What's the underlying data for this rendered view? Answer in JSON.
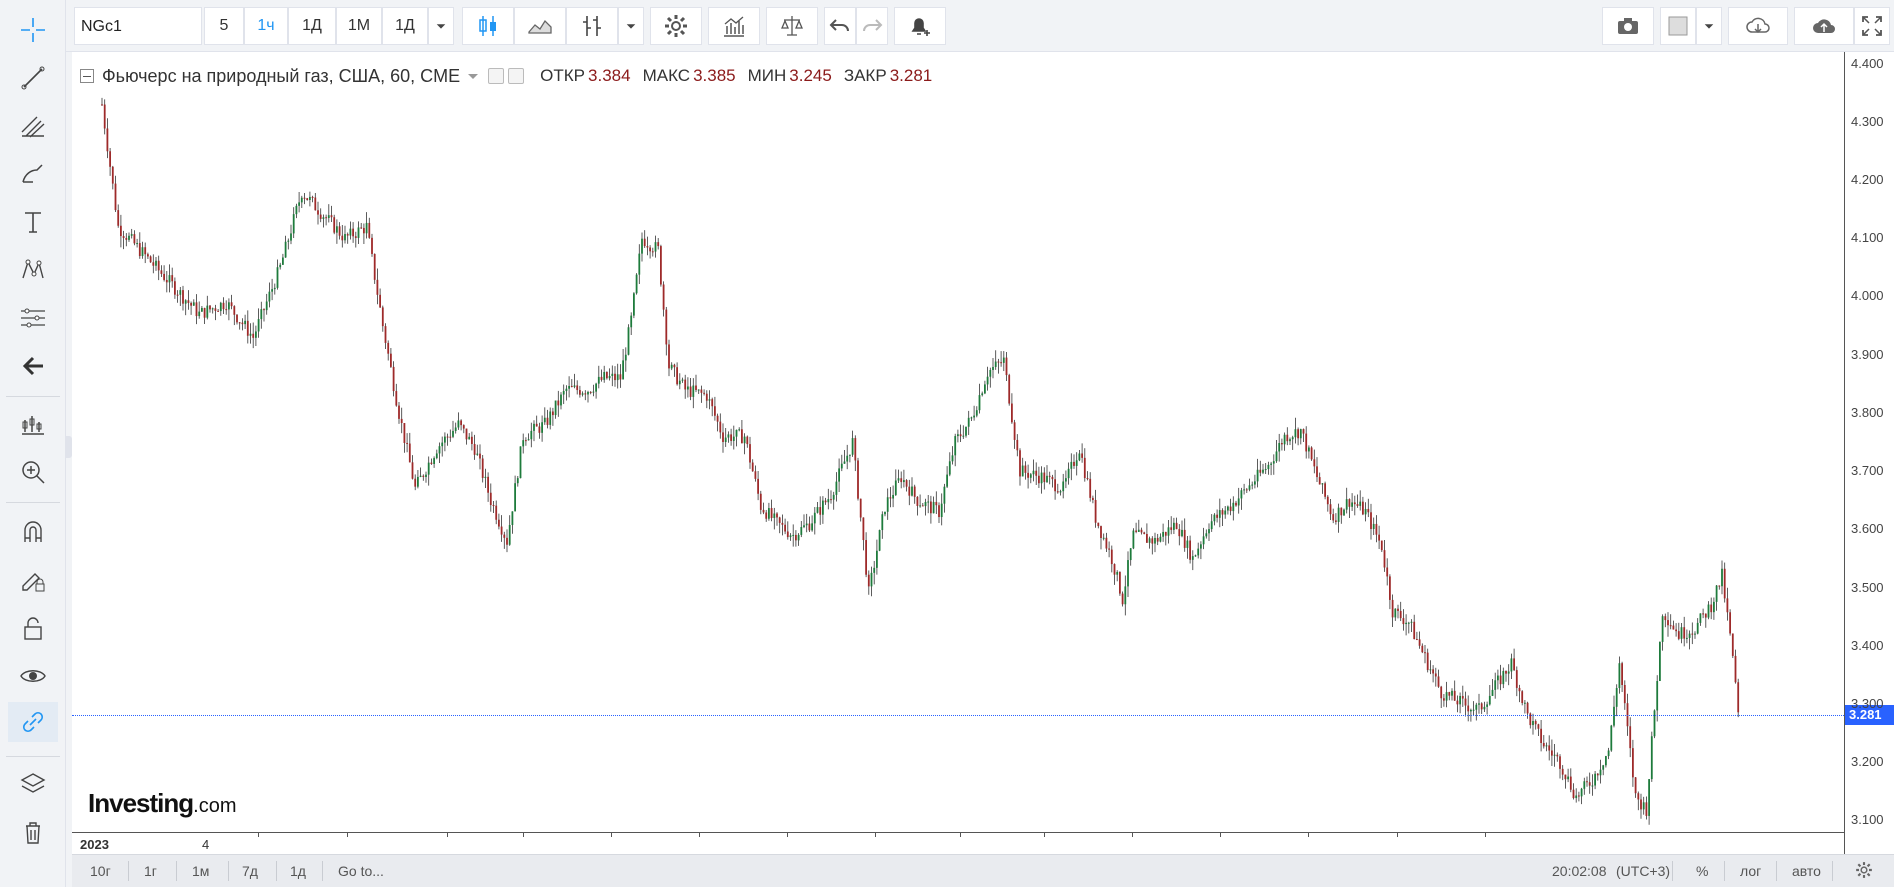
{
  "toolbar": {
    "symbol": "NGc1",
    "intervals": [
      "5",
      "1ч",
      "1Д",
      "1М",
      "1Д"
    ],
    "active_interval": "1ч"
  },
  "legend": {
    "title": "Фьючерс на природный газ, США, 60, CME",
    "open_label": "ОТКР",
    "open": "3.384",
    "high_label": "МАКС",
    "high": "3.385",
    "low_label": "МИН",
    "low": "3.245",
    "close_label": "ЗАКР",
    "close": "3.281"
  },
  "price_axis": {
    "ticks": [
      "4.400",
      "4.300",
      "4.200",
      "4.100",
      "4.000",
      "3.900",
      "3.800",
      "3.700",
      "3.600",
      "3.500",
      "3.400",
      "3.300",
      "3.200",
      "3.100"
    ],
    "current_price": "3.281"
  },
  "time_axis": {
    "labels": [
      "2023",
      "4"
    ]
  },
  "logo": {
    "brand": "Investing",
    "suffix": ".com"
  },
  "bottom_bar": {
    "ranges": [
      "10г",
      "1г",
      "1м",
      "7д",
      "1д"
    ],
    "goto": "Go to...",
    "time": "20:02:08",
    "tz": "(UTC+3)",
    "percent": "%",
    "log": "лог",
    "auto": "авто"
  },
  "colors": {
    "up": "#1e7b3c",
    "down": "#9e2a2a",
    "accent": "#2962ff"
  },
  "chart_data": {
    "type": "candlestick",
    "ylim": [
      3.08,
      4.42
    ],
    "anchors": [
      [
        0,
        4.33
      ],
      [
        6,
        4.12
      ],
      [
        16,
        4.07
      ],
      [
        26,
        4.02
      ],
      [
        36,
        3.97
      ],
      [
        46,
        3.99
      ],
      [
        56,
        3.93
      ],
      [
        66,
        4.05
      ],
      [
        74,
        4.18
      ],
      [
        82,
        4.14
      ],
      [
        90,
        4.1
      ],
      [
        98,
        4.12
      ],
      [
        104,
        3.95
      ],
      [
        110,
        3.8
      ],
      [
        116,
        3.67
      ],
      [
        124,
        3.74
      ],
      [
        132,
        3.78
      ],
      [
        138,
        3.74
      ],
      [
        144,
        3.65
      ],
      [
        150,
        3.58
      ],
      [
        156,
        3.76
      ],
      [
        164,
        3.78
      ],
      [
        172,
        3.84
      ],
      [
        180,
        3.84
      ],
      [
        186,
        3.86
      ],
      [
        192,
        3.86
      ],
      [
        196,
        3.96
      ],
      [
        200,
        4.1
      ],
      [
        206,
        4.08
      ],
      [
        210,
        3.88
      ],
      [
        216,
        3.84
      ],
      [
        224,
        3.83
      ],
      [
        230,
        3.76
      ],
      [
        238,
        3.76
      ],
      [
        244,
        3.64
      ],
      [
        250,
        3.61
      ],
      [
        256,
        3.59
      ],
      [
        262,
        3.61
      ],
      [
        270,
        3.66
      ],
      [
        278,
        3.75
      ],
      [
        284,
        3.49
      ],
      [
        290,
        3.64
      ],
      [
        296,
        3.69
      ],
      [
        302,
        3.65
      ],
      [
        310,
        3.63
      ],
      [
        316,
        3.75
      ],
      [
        322,
        3.79
      ],
      [
        328,
        3.87
      ],
      [
        334,
        3.89
      ],
      [
        340,
        3.7
      ],
      [
        348,
        3.69
      ],
      [
        356,
        3.67
      ],
      [
        362,
        3.74
      ],
      [
        368,
        3.62
      ],
      [
        374,
        3.55
      ],
      [
        378,
        3.48
      ],
      [
        382,
        3.59
      ],
      [
        390,
        3.58
      ],
      [
        398,
        3.61
      ],
      [
        404,
        3.55
      ],
      [
        410,
        3.61
      ],
      [
        418,
        3.64
      ],
      [
        426,
        3.68
      ],
      [
        432,
        3.71
      ],
      [
        438,
        3.76
      ],
      [
        444,
        3.77
      ],
      [
        450,
        3.69
      ],
      [
        456,
        3.62
      ],
      [
        462,
        3.65
      ],
      [
        468,
        3.63
      ],
      [
        474,
        3.57
      ],
      [
        478,
        3.46
      ],
      [
        484,
        3.44
      ],
      [
        490,
        3.38
      ],
      [
        496,
        3.32
      ],
      [
        504,
        3.3
      ],
      [
        510,
        3.29
      ],
      [
        516,
        3.33
      ],
      [
        522,
        3.37
      ],
      [
        528,
        3.28
      ],
      [
        534,
        3.23
      ],
      [
        540,
        3.2
      ],
      [
        546,
        3.14
      ],
      [
        552,
        3.17
      ],
      [
        558,
        3.22
      ],
      [
        562,
        3.37
      ],
      [
        568,
        3.14
      ],
      [
        572,
        3.12
      ],
      [
        578,
        3.46
      ],
      [
        584,
        3.42
      ],
      [
        590,
        3.43
      ],
      [
        596,
        3.47
      ],
      [
        600,
        3.52
      ],
      [
        604,
        3.38
      ],
      [
        606,
        3.28
      ]
    ],
    "candle_count": 607
  }
}
